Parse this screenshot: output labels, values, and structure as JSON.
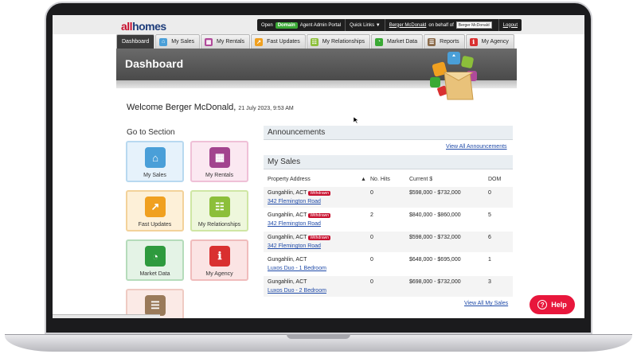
{
  "app": {
    "logo_part1": "all",
    "logo_part2": "homes"
  },
  "utility": {
    "open_label": "Open",
    "domain_label": "Domain",
    "portal_label": "Agent Admin Portal",
    "quick_links": "Quick Links ▼",
    "user_name": "Berger McDonald",
    "behalf": "on behalf of",
    "agent_select": "Berger McDonald",
    "logout": "Logout"
  },
  "tabs": [
    {
      "label": "Dashboard",
      "icon": "dashboard-icon",
      "color": ""
    },
    {
      "label": "My Sales",
      "icon": "house-icon",
      "color": "#4a9fd8"
    },
    {
      "label": "My Rentals",
      "icon": "building-icon",
      "color": "#b04a9a"
    },
    {
      "label": "Fast Updates",
      "icon": "lightning-icon",
      "color": "#f0a020"
    },
    {
      "label": "My Relationships",
      "icon": "people-icon",
      "color": "#8cbf3a"
    },
    {
      "label": "Market Data",
      "icon": "pie-chart-icon",
      "color": "#3aa935"
    },
    {
      "label": "Reports",
      "icon": "report-icon",
      "color": "#8a6a4a"
    },
    {
      "label": "My Agency",
      "icon": "agency-icon",
      "color": "#d93030"
    }
  ],
  "banner": {
    "title": "Dashboard"
  },
  "welcome": {
    "greeting": "Welcome Berger McDonald,",
    "date": "21 July 2023, 9:53 AM"
  },
  "goto": {
    "title": "Go to Section",
    "tiles": [
      {
        "label": "My Sales",
        "icon": "house-icon",
        "glyph": "⌂",
        "color": "#4a9fd8",
        "bg": "#e6f2fb",
        "border": "#b8d9f0"
      },
      {
        "label": "My Rentals",
        "icon": "building-icon",
        "glyph": "▦",
        "color": "#a2448e",
        "bg": "#fbe8f1",
        "border": "#efc0d7"
      },
      {
        "label": "Fast Updates",
        "icon": "lightning-icon",
        "glyph": "↗",
        "color": "#f0a020",
        "bg": "#fdf0d8",
        "border": "#f3d29a"
      },
      {
        "label": "My Relationships",
        "icon": "people-icon",
        "glyph": "☷",
        "color": "#8cbf3a",
        "bg": "#eef7dc",
        "border": "#cfe6a4"
      },
      {
        "label": "Market Data",
        "icon": "pie-chart-icon",
        "glyph": "◔",
        "color": "#2e9a3e",
        "bg": "#e4f3e6",
        "border": "#b5dcbb"
      },
      {
        "label": "My Agency",
        "icon": "agency-icon",
        "glyph": "ℹ",
        "color": "#d93030",
        "bg": "#fbe4e4",
        "border": "#f0bcbc"
      },
      {
        "label": "",
        "icon": "report-icon",
        "glyph": "☰",
        "color": "#9a7a5a",
        "bg": "#fbeae6",
        "border": "#efcbc3"
      }
    ]
  },
  "announcements": {
    "title": "Announcements",
    "view_all": "View All Announcements"
  },
  "sales": {
    "title": "My Sales",
    "headers": {
      "address": "Property Address",
      "hits": "No. Hits",
      "current": "Current $",
      "dom": "DOM"
    },
    "rows": [
      {
        "suburb": "Gungahlin, ACT",
        "badge": "Withdrawn",
        "address": "342 Flemington Road",
        "hits": "0",
        "price": "$598,000 - $732,000",
        "dom": "0"
      },
      {
        "suburb": "Gungahlin, ACT",
        "badge": "Withdrawn",
        "address": "342 Flemington Road",
        "hits": "2",
        "price": "$840,000 - $860,000",
        "dom": "5"
      },
      {
        "suburb": "Gungahlin, ACT",
        "badge": "Withdrawn",
        "address": "342 Flemington Road",
        "hits": "0",
        "price": "$598,000 - $732,000",
        "dom": "6"
      },
      {
        "suburb": "Gungahlin, ACT",
        "badge": "",
        "address": "Luxos Duo - 1 Bedroom",
        "hits": "0",
        "price": "$648,000 - $695,000",
        "dom": "1"
      },
      {
        "suburb": "Gungahlin, ACT",
        "badge": "",
        "address": "Luxos Duo - 2 Bedroom",
        "hits": "0",
        "price": "$698,000 - $732,000",
        "dom": "3"
      }
    ],
    "view_all": "View All My Sales"
  },
  "help": {
    "label": "Help",
    "glyph": "?"
  }
}
